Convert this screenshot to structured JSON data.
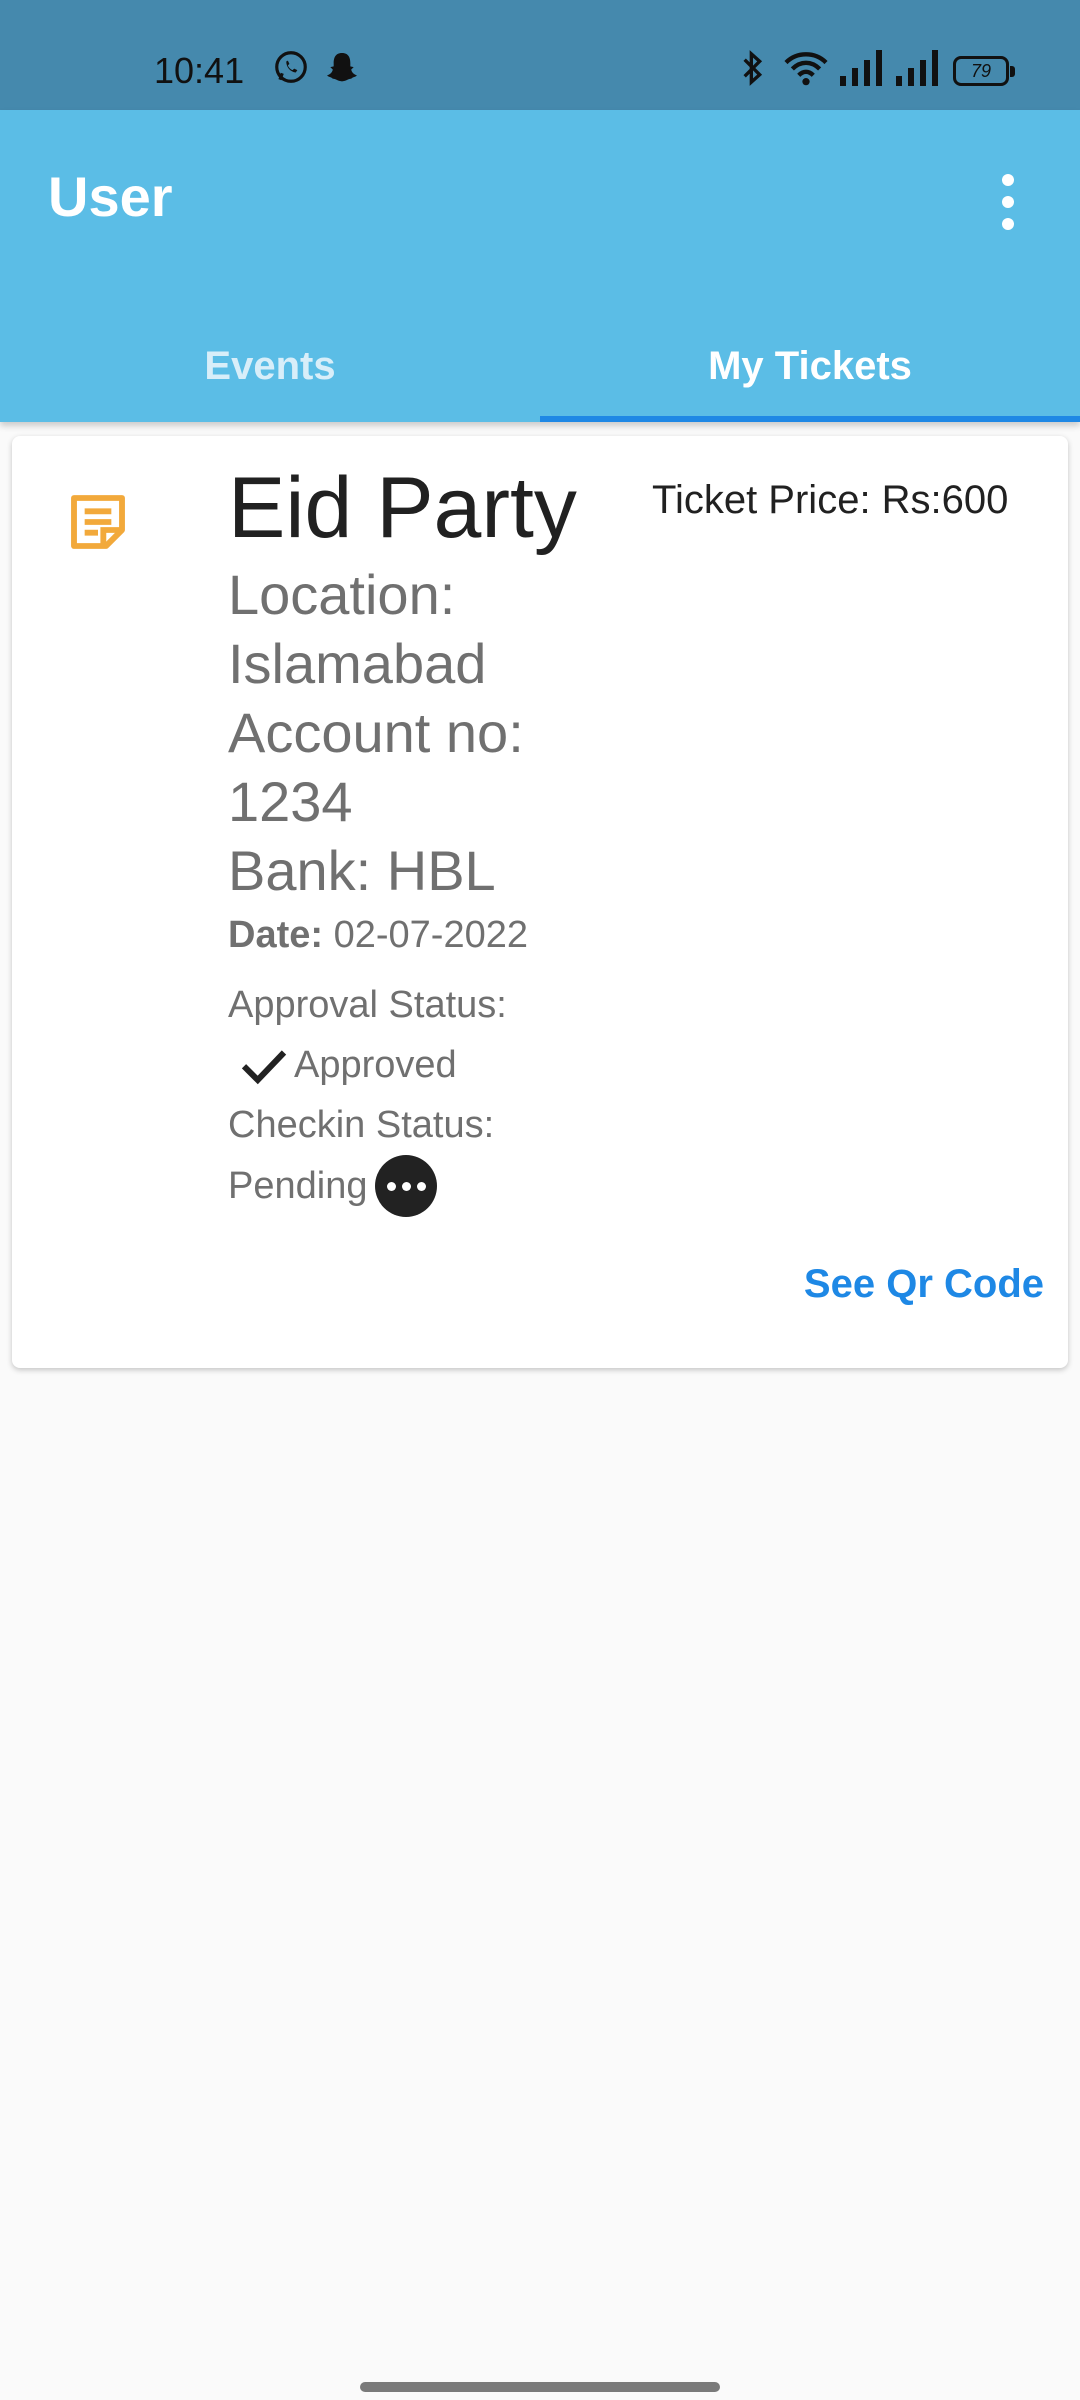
{
  "status_bar": {
    "time": "10:41",
    "battery": "79",
    "icons": [
      "whatsapp-icon",
      "snapchat-icon",
      "bluetooth-icon",
      "wifi-icon",
      "signal-icon",
      "signal-icon"
    ]
  },
  "app_bar": {
    "title": "User",
    "menu_icon": "more-vert-icon"
  },
  "tabs": [
    {
      "label": "Events",
      "selected": false
    },
    {
      "label": "My Tickets",
      "selected": true
    }
  ],
  "ticket": {
    "title": "Eid Party",
    "location": "Location: Islamabad",
    "account": "Account no: 1234",
    "bank": "Bank: HBL",
    "date_label": "Date:",
    "date_value": "02-07-2022",
    "approval_label": "Approval Status:",
    "approval_value": "Approved",
    "checkin_label": "Checkin Status:",
    "checkin_value": "Pending",
    "price": "Ticket Price: Rs:600",
    "qr_action": "See Qr Code"
  },
  "colors": {
    "status_bar": "#4589ad",
    "app_bar": "#5bbde6",
    "accent": "#1e88e5",
    "note_icon": "#f2a93b"
  }
}
